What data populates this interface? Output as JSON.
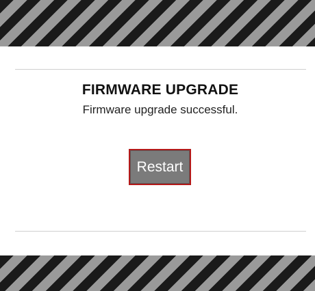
{
  "dialog": {
    "title": "FIRMWARE UPGRADE",
    "message": "Firmware upgrade successful.",
    "restart_label": "Restart"
  },
  "colors": {
    "hazard_dark": "#1a1a1a",
    "hazard_light": "#9a9a9a",
    "button_fill": "#7b7b7b",
    "button_border": "#b41a1a",
    "background": "#ffffff"
  }
}
